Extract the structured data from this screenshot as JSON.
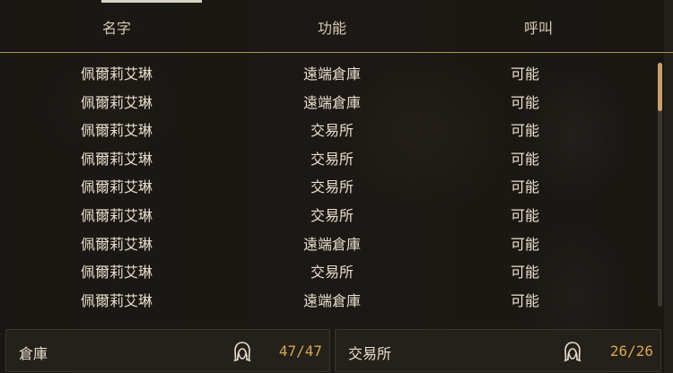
{
  "header": {
    "name": "名字",
    "function": "功能",
    "call": "呼叫"
  },
  "rows": [
    {
      "name": "佩爾莉艾琳",
      "function": "遠端倉庫",
      "call": "可能"
    },
    {
      "name": "佩爾莉艾琳",
      "function": "遠端倉庫",
      "call": "可能"
    },
    {
      "name": "佩爾莉艾琳",
      "function": "交易所",
      "call": "可能"
    },
    {
      "name": "佩爾莉艾琳",
      "function": "交易所",
      "call": "可能"
    },
    {
      "name": "佩爾莉艾琳",
      "function": "交易所",
      "call": "可能"
    },
    {
      "name": "佩爾莉艾琳",
      "function": "交易所",
      "call": "可能"
    },
    {
      "name": "佩爾莉艾琳",
      "function": "遠端倉庫",
      "call": "可能"
    },
    {
      "name": "佩爾莉艾琳",
      "function": "交易所",
      "call": "可能"
    },
    {
      "name": "佩爾莉艾琳",
      "function": "遠端倉庫",
      "call": "可能"
    }
  ],
  "footer": {
    "warehouse": {
      "label": "倉庫",
      "value": "47/47",
      "icon": "maid-icon"
    },
    "exchange": {
      "label": "交易所",
      "value": "26/26",
      "icon": "maid-icon"
    }
  },
  "colors": {
    "accent": "#d7a84a",
    "divider": "#b08f4e",
    "scroll_thumb": "#c9a06a"
  }
}
